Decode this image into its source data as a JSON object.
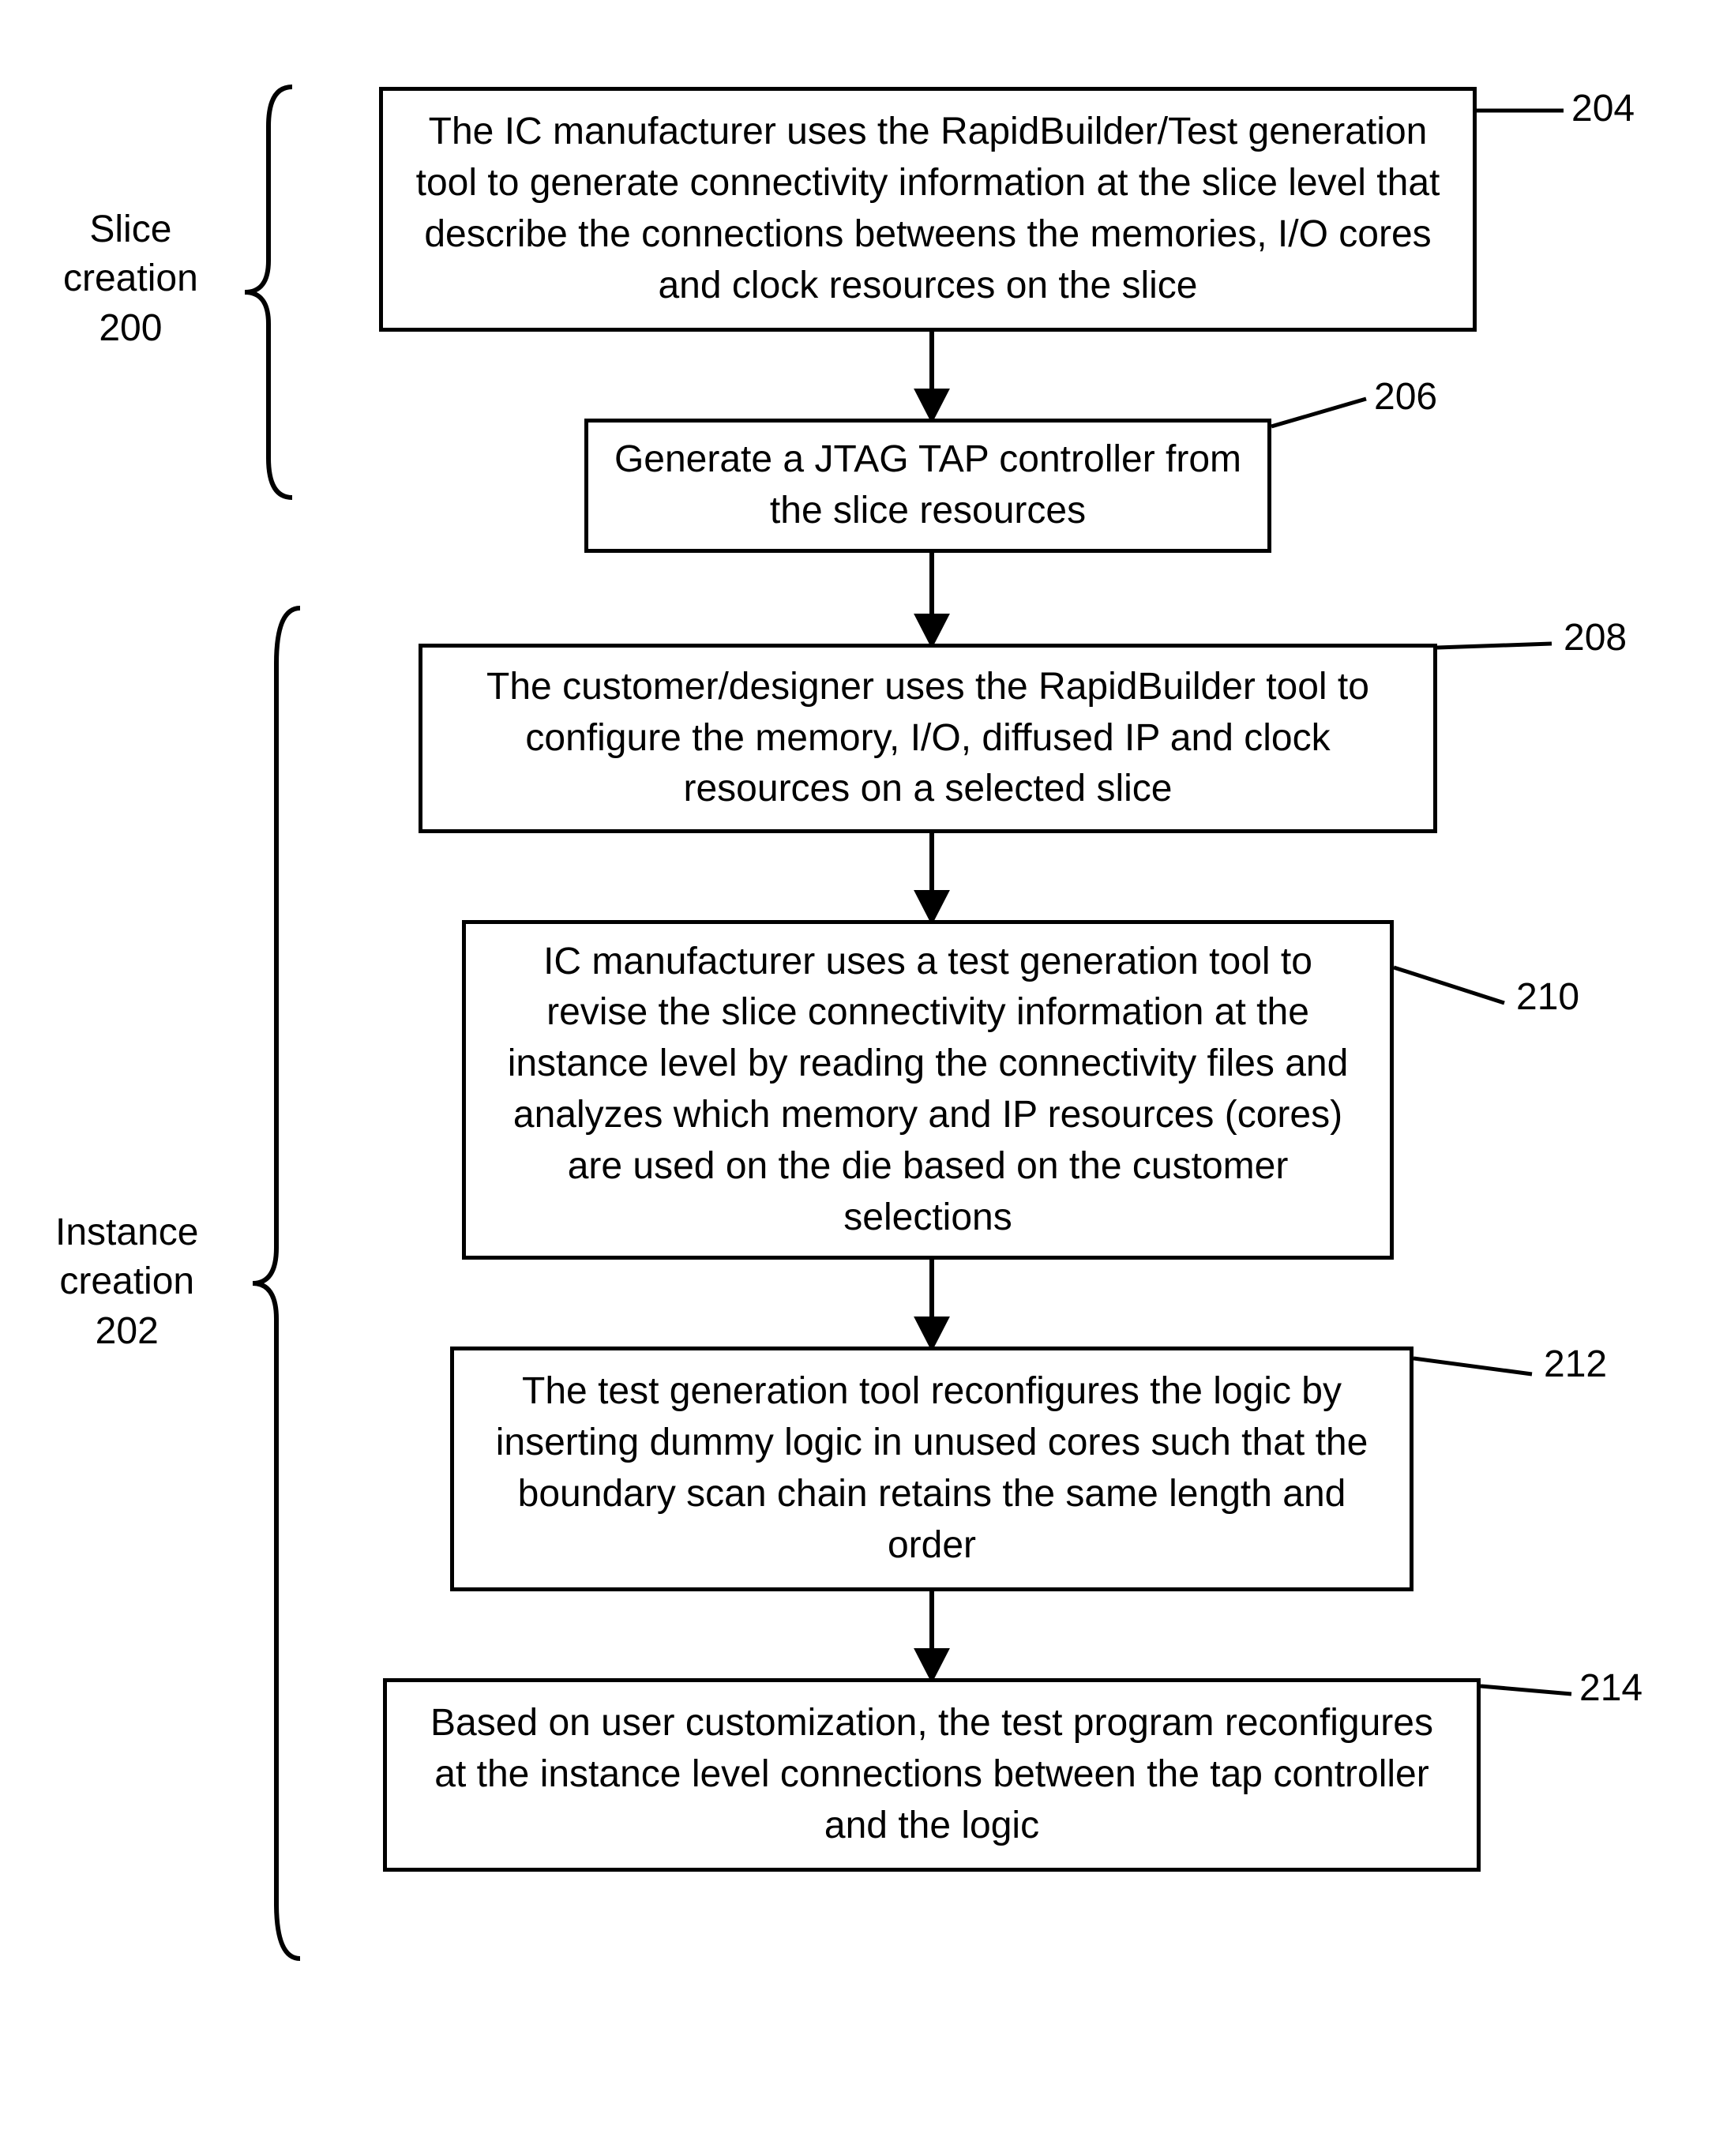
{
  "labels": {
    "slice_creation": "Slice\ncreation\n200",
    "instance_creation": "Instance\ncreation\n202",
    "ref_204": "204",
    "ref_206": "206",
    "ref_208": "208",
    "ref_210": "210",
    "ref_212": "212",
    "ref_214": "214"
  },
  "boxes": {
    "box_204": "The IC manufacturer uses the RapidBuilder/Test generation tool to generate  connectivity information at the slice level that describe the connections betweens the memories, I/O cores and clock resources on the slice",
    "box_206": "Generate a JTAG TAP controller from the slice resources",
    "box_208": "The customer/designer uses the RapidBuilder tool to configure the memory, I/O, diffused IP and clock resources on a selected slice",
    "box_210": "IC manufacturer uses a test generation tool to revise the slice connectivity information at the instance level by reading the connectivity files and analyzes which memory and IP resources (cores) are used on the die based on the customer selections",
    "box_212": "The test generation tool reconfigures the logic by inserting dummy logic in unused cores such that the boundary scan chain retains the same length and order",
    "box_214": "Based on user customization, the test program reconfigures at the instance level connections between the tap controller and the logic"
  }
}
